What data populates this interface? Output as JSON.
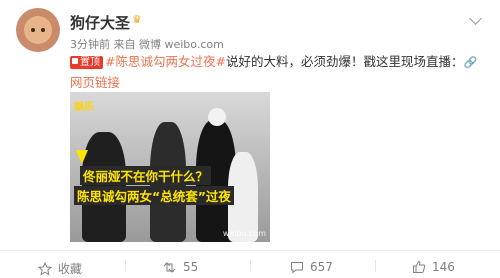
{
  "post": {
    "username": "狗仔大圣",
    "badge_icon": "crown-icon",
    "meta": "3分钟前 来自 微博 weibo.com",
    "pin_label": "置顶",
    "hashtag": "#陈思诚勾两女过夜#",
    "text": "说好的大料，必须劲爆！戳这里现场直播：",
    "link_icon": "link-icon",
    "link_text": "网页链接"
  },
  "image": {
    "logo_text": "娱乐",
    "caption_line1": "佟丽娅不在你干什么？",
    "caption_line2": "陈思诚勾两女“总统套”过夜",
    "watermark": "weibo.com"
  },
  "actions": {
    "favorite_label": "收藏",
    "repost_count": "55",
    "comment_count": "657",
    "like_count": "146"
  },
  "colors": {
    "accent": "#eb7350",
    "pin_bg": "#e83a2a",
    "text": "#333333",
    "muted": "#808080"
  }
}
